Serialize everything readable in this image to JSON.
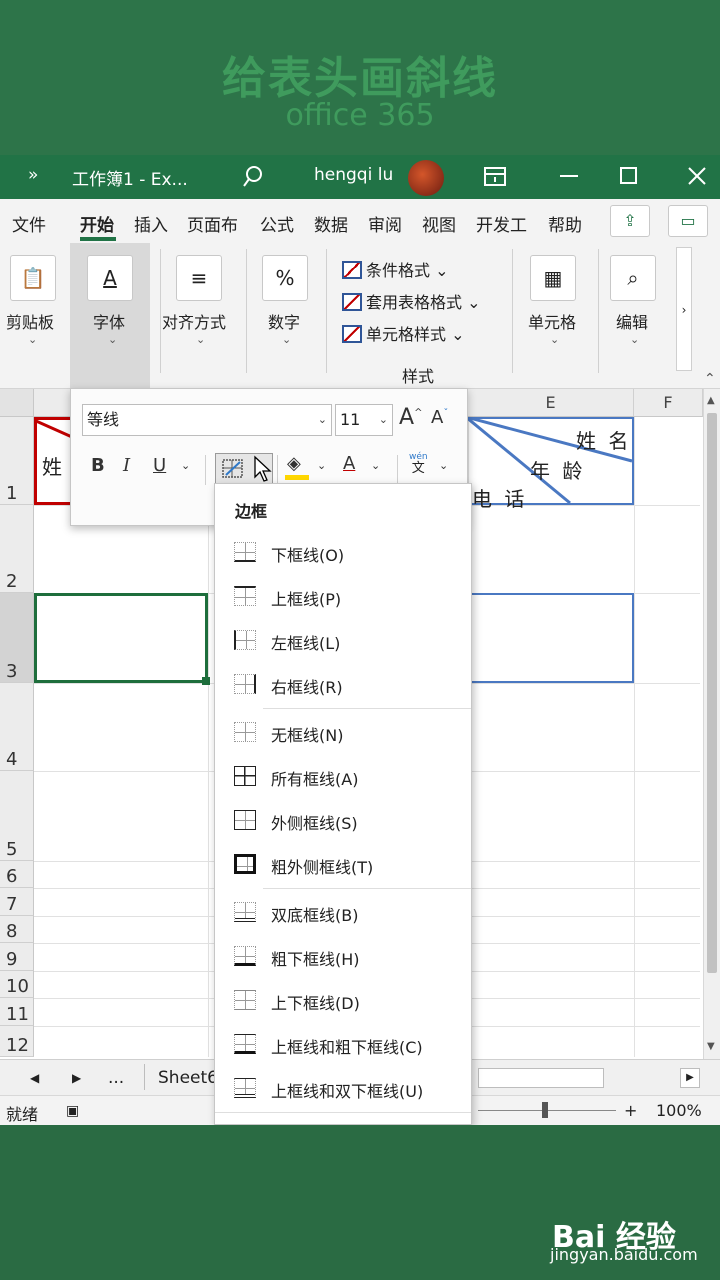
{
  "banner": {
    "title": "给表头画斜线",
    "subtitle": "office 365"
  },
  "titlebar": {
    "more": "»",
    "doc_title": "工作簿1 - Ex...",
    "user": "hengqi lu"
  },
  "menu": {
    "items": [
      "文件",
      "开始",
      "插入",
      "页面布",
      "公式",
      "数据",
      "审阅",
      "视图",
      "开发工",
      "帮助"
    ],
    "active": "开始"
  },
  "ribbon": {
    "groups": [
      "剪贴板",
      "字体",
      "对齐方式",
      "数字",
      "单元格",
      "编辑"
    ],
    "styles": {
      "conditional": "条件格式",
      "table": "套用表格格式",
      "cell": "单元格样式",
      "label": "样式"
    }
  },
  "sheet": {
    "columns": [
      "E",
      "F"
    ],
    "rows": [
      "1",
      "2",
      "3",
      "4",
      "5",
      "6",
      "7",
      "8",
      "9",
      "10",
      "11",
      "12"
    ],
    "cells": {
      "a1_partial": "姓",
      "e1_name": "姓 名",
      "e1_age": "年 龄",
      "e1_phone": "电 话"
    }
  },
  "fontbar": {
    "font_name": "等线",
    "font_size": "11",
    "bold": "B",
    "italic": "I",
    "underline": "U",
    "grow": "A",
    "shrink": "A",
    "color": "A",
    "phonetic_top": "wén",
    "phonetic_bot": "文"
  },
  "border_menu": {
    "title": "边框",
    "items": [
      "下框线(O)",
      "上框线(P)",
      "左框线(L)",
      "右框线(R)",
      "无框线(N)",
      "所有框线(A)",
      "外侧框线(S)",
      "粗外侧框线(T)",
      "双底框线(B)",
      "粗下框线(H)",
      "上下框线(D)",
      "上框线和粗下框线(C)",
      "上框线和双下框线(U)"
    ]
  },
  "tabs": {
    "sheet_name": "Sheet6",
    "more": "..."
  },
  "status": {
    "ready": "就绪",
    "zoom": "100%",
    "plus": "+"
  },
  "watermark": {
    "brand": "Bai 经验",
    "url": "jingyan.baidu.com"
  },
  "colors": {
    "excel_green": "#217346",
    "selected_border": "#1e6e3c",
    "blue_border": "#4472c4",
    "red_border": "#c00000"
  }
}
